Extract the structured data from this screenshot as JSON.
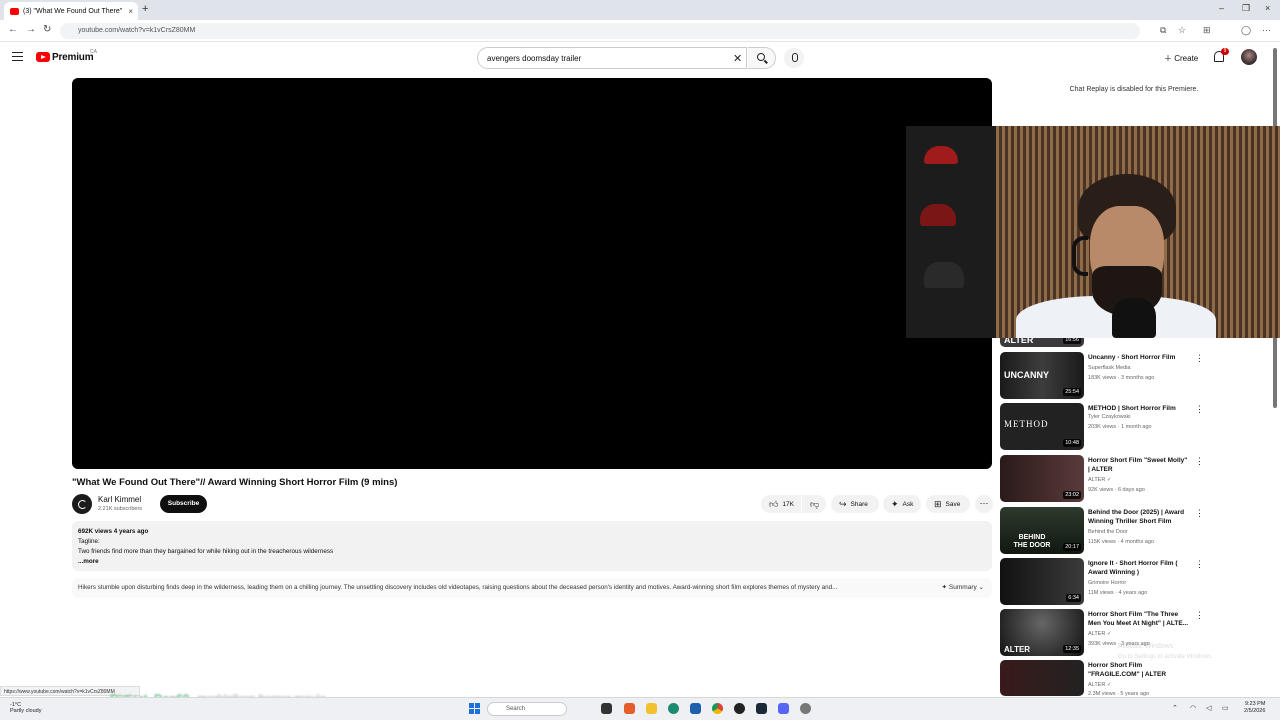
{
  "browser": {
    "tab_title": "(3) \"What We Found Out There\"",
    "tab_close": "×",
    "new_tab": "+",
    "url": "youtube.com/watch?v=k1vCrsZ80MM",
    "win_min": "–",
    "win_max": "❐",
    "win_close": "×"
  },
  "header": {
    "brand": "Premium",
    "country_code": "CA",
    "search_value": "avengers doomsday trailer",
    "search_clear": "✕",
    "create_label": "Create",
    "notif_count": "9"
  },
  "video": {
    "title": "\"What We Found Out There\"// Award Winning Short Horror Film (9 mins)",
    "channel": "Karl Kimmel",
    "subscribers": "2.21K subscribers",
    "subscribe_label": "Subscribe",
    "likes": "17K",
    "share_label": "Share",
    "ask_label": "Ask",
    "save_label": "Save",
    "more_label": "⋯"
  },
  "description": {
    "meta": "692K views  4 years ago",
    "tagline_label": "Tagline:",
    "tagline": "Two friends find more than they bargained for while hiking out in the treacherous wilderness",
    "more": "...more"
  },
  "summary": {
    "text": "Hikers stumble upon disturbing finds deep in the wilderness, leading them on a chilling journey. The unsettling discovery includes old videotapes, raising questions about the deceased person's identity and motives. Award-winning short film explores themes of mystery and...",
    "label": "✦ Summary"
  },
  "chat": {
    "message": "Chat Replay is disabled for this Premiere."
  },
  "sidebar": {
    "items": [
      {
        "thumb_text": "ALTER",
        "duration": "16:56",
        "title": "",
        "channel": "",
        "views": ""
      },
      {
        "thumb_text": "UNCANNY",
        "duration": "25:54",
        "title": "Uncanny - Short Horror Film",
        "channel": "Superflask Media",
        "views": "183K views · 3 months ago"
      },
      {
        "thumb_text": "METHOD",
        "duration": "10:48",
        "title": "METHOD | Short Horror Film",
        "channel": "Tyler Czaykowski",
        "views": "203K views · 1 month ago"
      },
      {
        "thumb_text": "",
        "duration": "23:02",
        "title": "Horror Short Film \"Sweet Molly\" | ALTER",
        "channel": "ALTER ✓",
        "views": "92K views · 6 days ago"
      },
      {
        "thumb_text": "BEHIND THE DOOR",
        "duration": "20:17",
        "title": "Behind the Door (2025) | Award Winning Thriller Short Film",
        "channel": "Behind the Door",
        "views": "115K views · 4 months ago"
      },
      {
        "thumb_text": "",
        "duration": "6:34",
        "title": "Ignore It - Short Horror Film ( Award Winning )",
        "channel": "Grimoire Horror",
        "views": "11M views · 4 years ago"
      },
      {
        "thumb_text": "ALTER",
        "duration": "12:35",
        "title": "Horror Short Film \"The Three Men You Meet At Night\" | ALTE...",
        "channel": "ALTER ✓",
        "views": "393K views · 3 years ago"
      },
      {
        "thumb_text": "",
        "duration": "",
        "title": "Horror Short Film \"FRAGILE.COM\" | ALTER",
        "channel": "ALTER ✓",
        "views": "2.3M views · 5 years ago"
      }
    ]
  },
  "overlays": {
    "status_url": "https://www.youtube.com/watch?v=k1vCrsZ80MM",
    "stream_user": "Dirtiest_Dan69",
    "stream_msg": "markipliers horror movie",
    "watermark1": "Activate Windows",
    "watermark2": "Go to Settings to activate Windows."
  },
  "taskbar": {
    "weather_temp": "-1°C",
    "weather_desc": "Partly cloudy",
    "search_label": "Search",
    "time": "9:23 PM",
    "date": "2/5/2026"
  },
  "colors": {
    "accent": "#ff0000",
    "subscribe_bg": "#0f0f0f",
    "stream_user": "#7ff0a8"
  }
}
